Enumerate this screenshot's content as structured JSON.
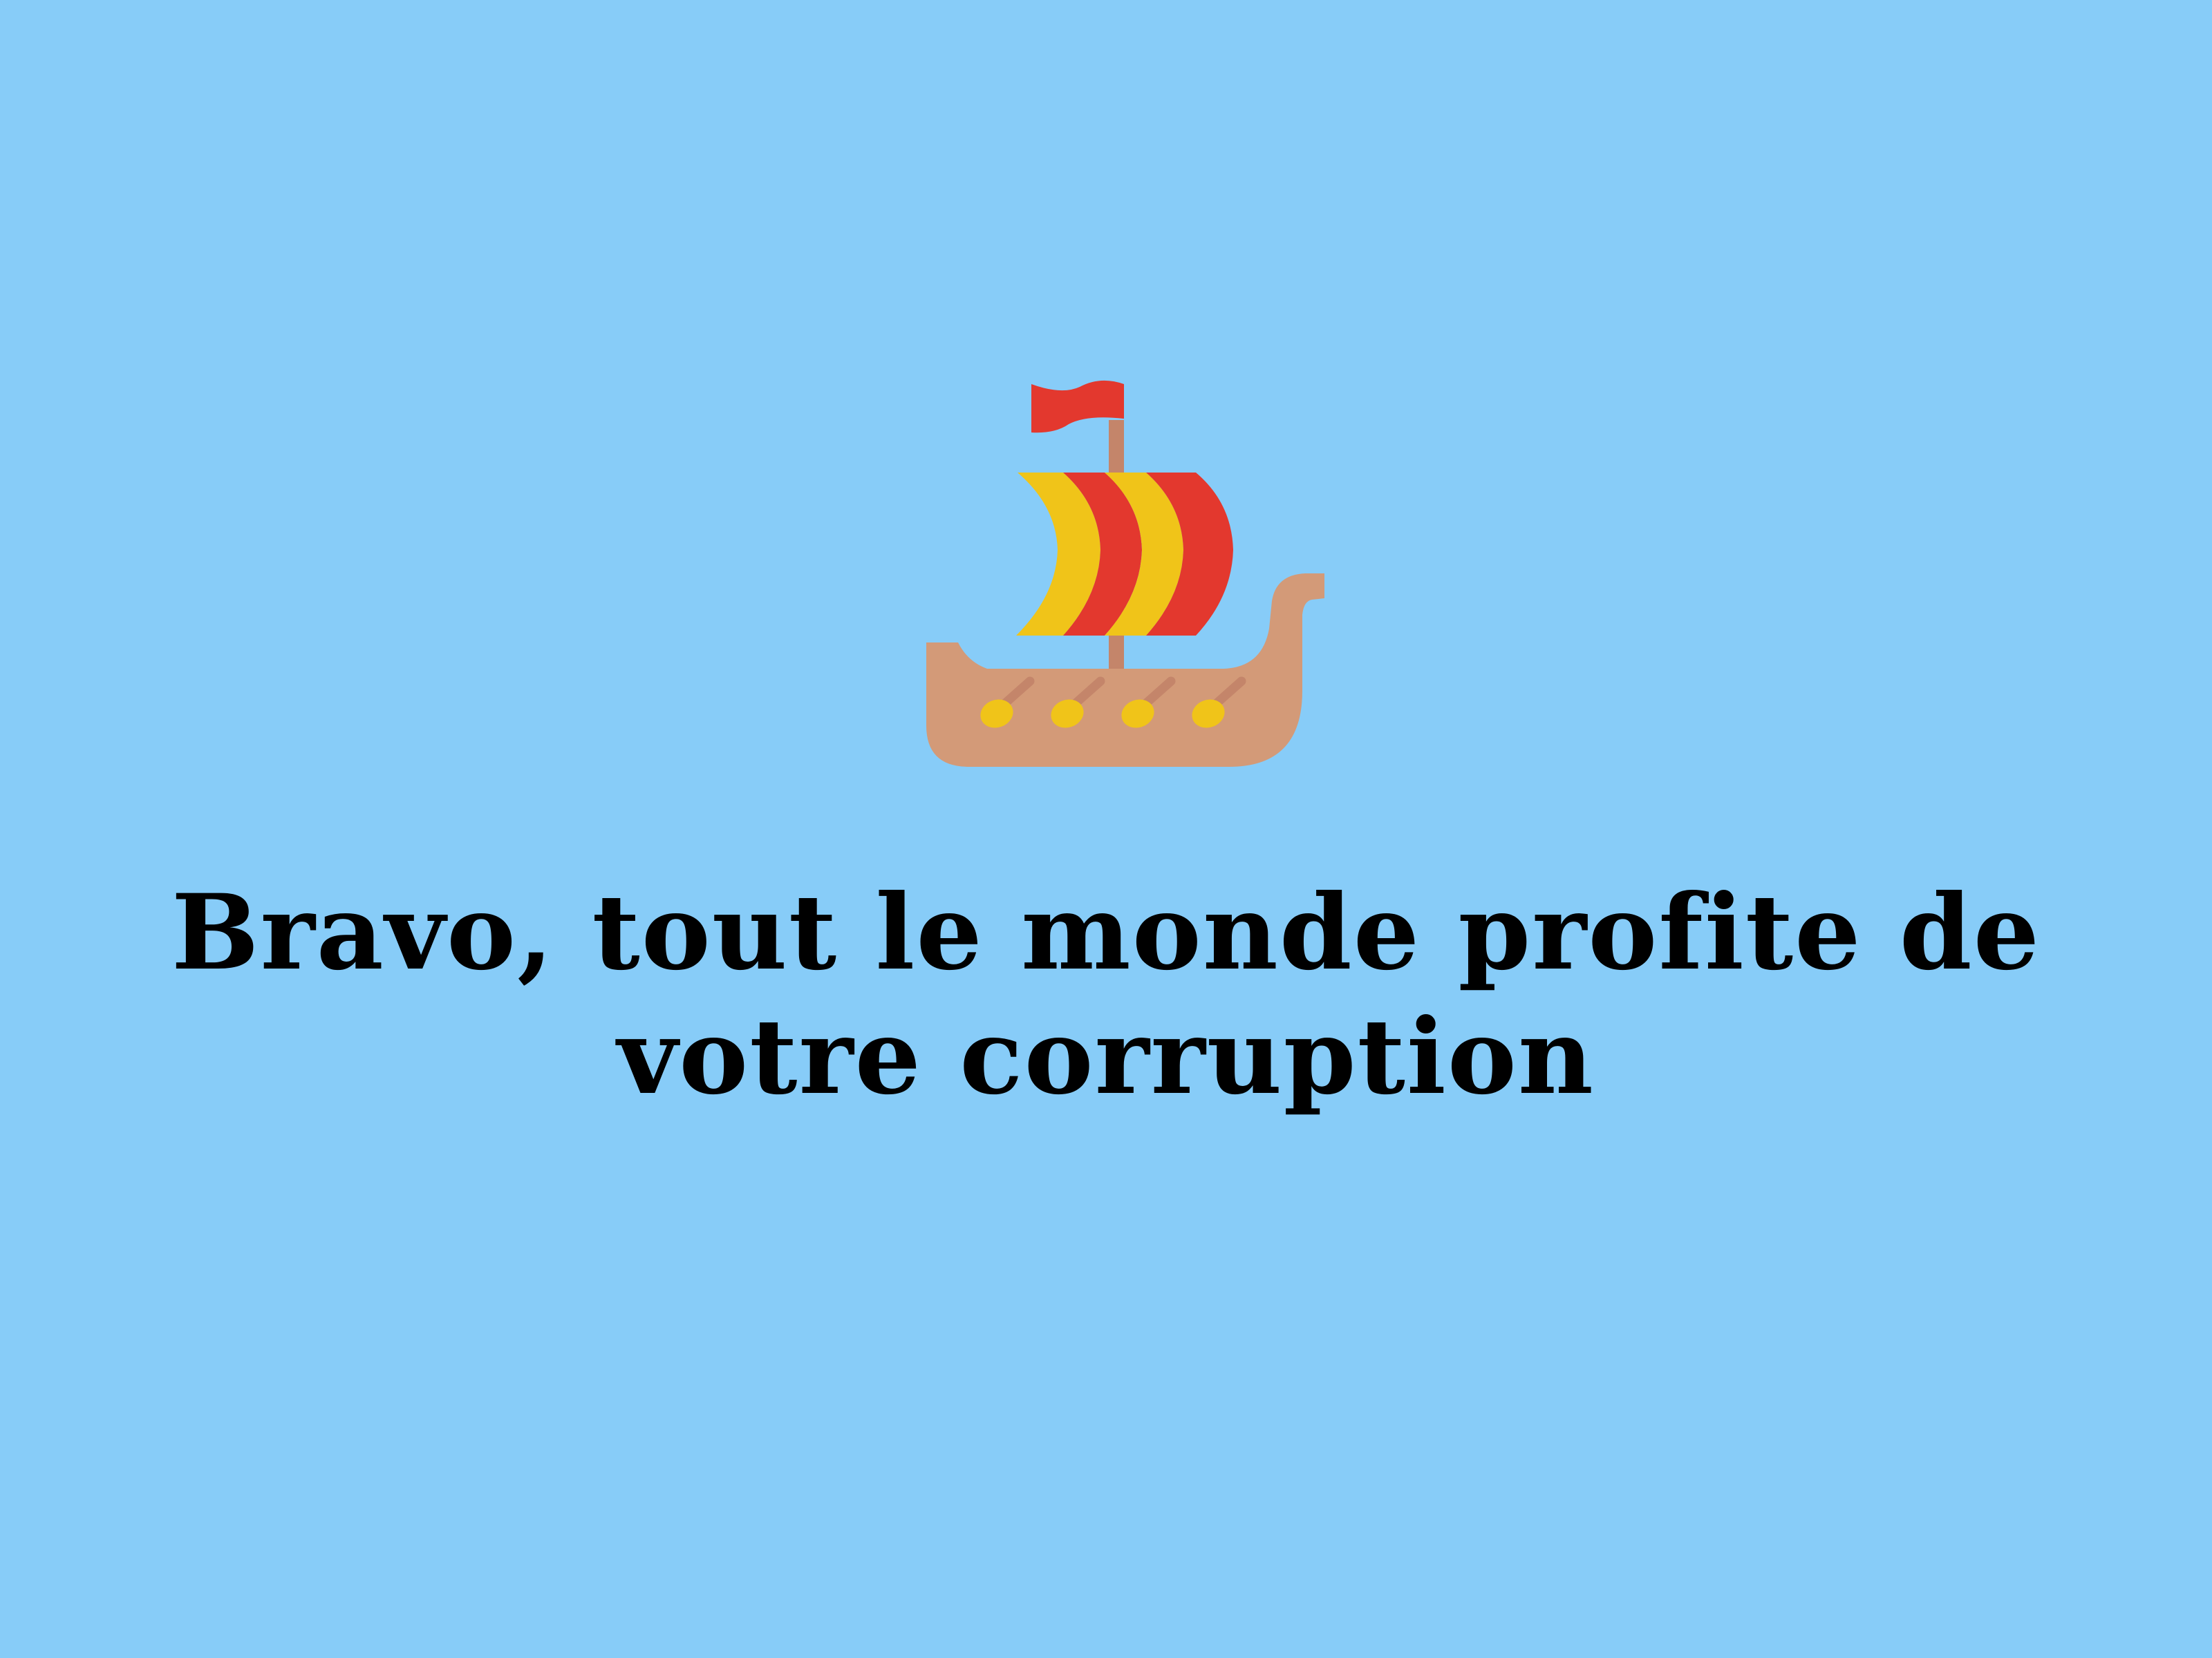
{
  "screen": {
    "background_color": "#87CCF8",
    "message": "Bravo, tout le monde profite de votre corruption"
  },
  "illustration": {
    "icon": "viking-ship-icon",
    "colors": {
      "hull": "#D39A78",
      "mast": "#C4856A",
      "flag": "#E3382E",
      "sail_red": "#E3382E",
      "sail_yellow": "#F0C419",
      "oar_blade": "#F0C419",
      "oar_shaft": "#C4856A"
    }
  }
}
